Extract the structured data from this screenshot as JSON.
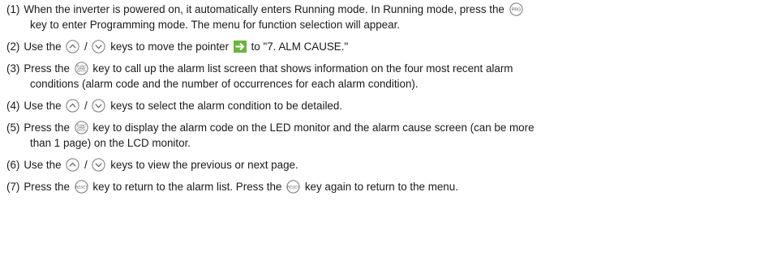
{
  "steps": [
    {
      "num": "(1)",
      "a": "When the inverter is powered on, it automatically enters Running mode. In Running mode, press the",
      "key": "PRG",
      "b": "key to enter Programming mode. The menu for function selection will appear."
    },
    {
      "num": "(2)",
      "a": "Use the",
      "b": "/",
      "c": "keys to move the pointer",
      "d": "to \"7. ALM CAUSE.\""
    },
    {
      "num": "(3)",
      "a": "Press the",
      "key": "FUNC DATA",
      "b": "key to call up the alarm list screen that shows information on the four most recent alarm",
      "c": "conditions (alarm code and the number of occurrences for each alarm condition)."
    },
    {
      "num": "(4)",
      "a": "Use the",
      "b": "/",
      "c": "keys to select the alarm condition to be detailed."
    },
    {
      "num": "(5)",
      "a": "Press the",
      "key": "FUNC DATA",
      "b": "key to display the alarm code on the LED monitor and the alarm cause screen (can be more",
      "c": "than 1 page) on the LCD monitor."
    },
    {
      "num": "(6)",
      "a": "Use the",
      "b": "/",
      "c": "keys to view the previous or next page."
    },
    {
      "num": "(7)",
      "a": "Press the",
      "key": "RESET",
      "b": "key to return to the alarm list. Press the",
      "c": "key again to return to the menu."
    }
  ]
}
